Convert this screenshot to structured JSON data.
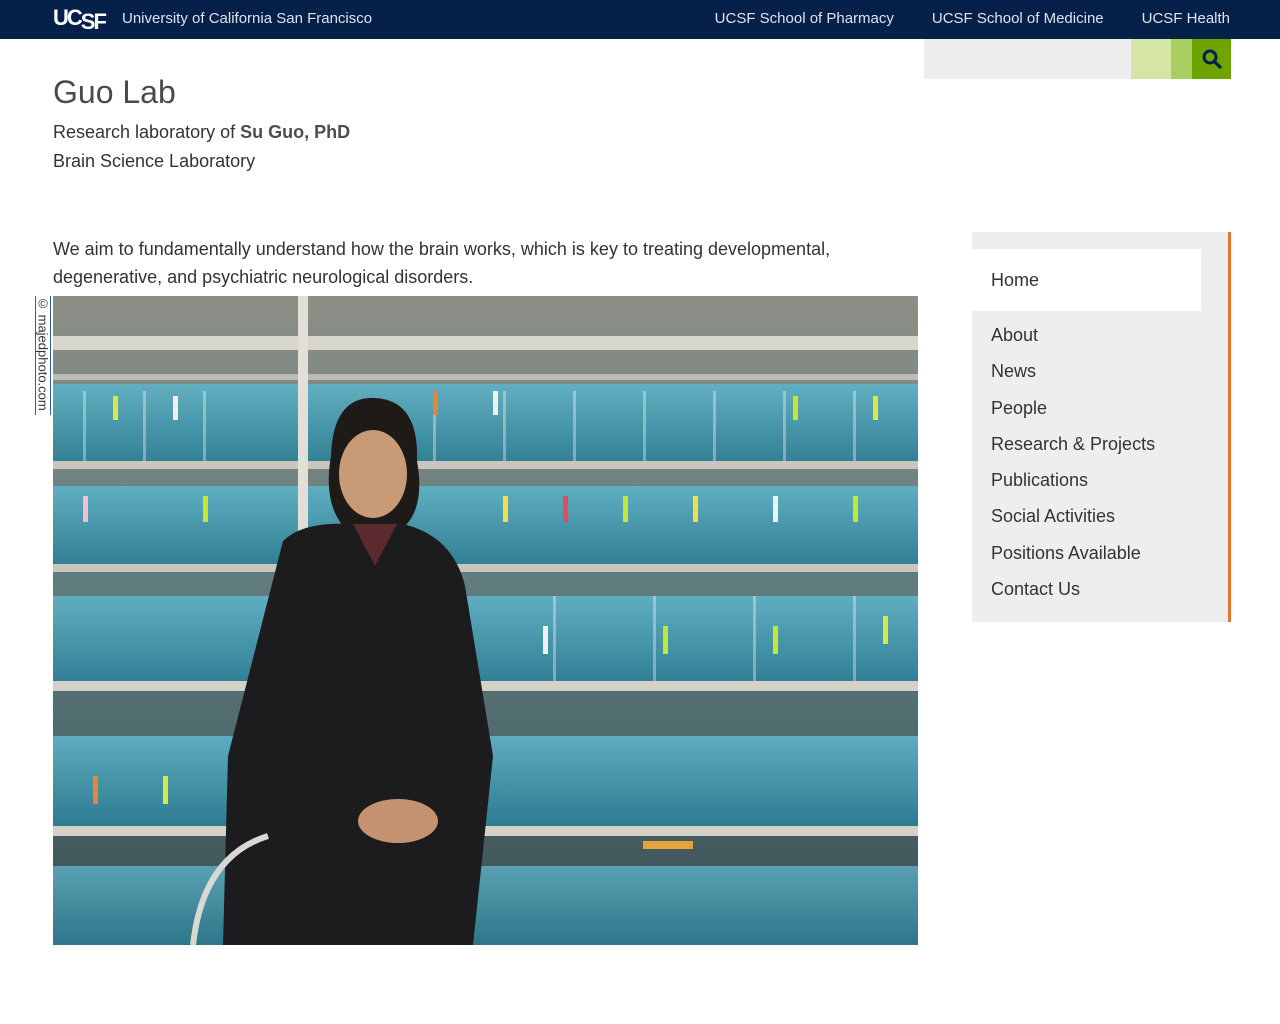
{
  "topbar": {
    "logo_text": "UCSF",
    "university": "University of California San Francisco",
    "links": [
      "UCSF School of Pharmacy",
      "UCSF School of Medicine",
      "UCSF Health"
    ]
  },
  "search": {
    "placeholder": "",
    "icon": "search-icon"
  },
  "header": {
    "title": "Guo Lab",
    "subtitle_prefix": "Research laboratory of ",
    "subtitle_name": "Su Guo, PhD",
    "subtitle2": "Brain Science Laboratory"
  },
  "main": {
    "intro": "We aim to fundamentally understand how the brain works, which is key to treating developmental, degenerative, and psychiatric neurological disorders.",
    "photo_credit": "© majedphoto.com"
  },
  "sidenav": {
    "home": "Home",
    "items": [
      "About",
      "News",
      "People",
      "Research & Projects",
      "Publications",
      "Social Activities",
      "Positions Available",
      "Contact Us"
    ]
  },
  "colors": {
    "topbar": "#052049",
    "accent_green": "#6ea400",
    "nav_border": "#e0782b"
  }
}
